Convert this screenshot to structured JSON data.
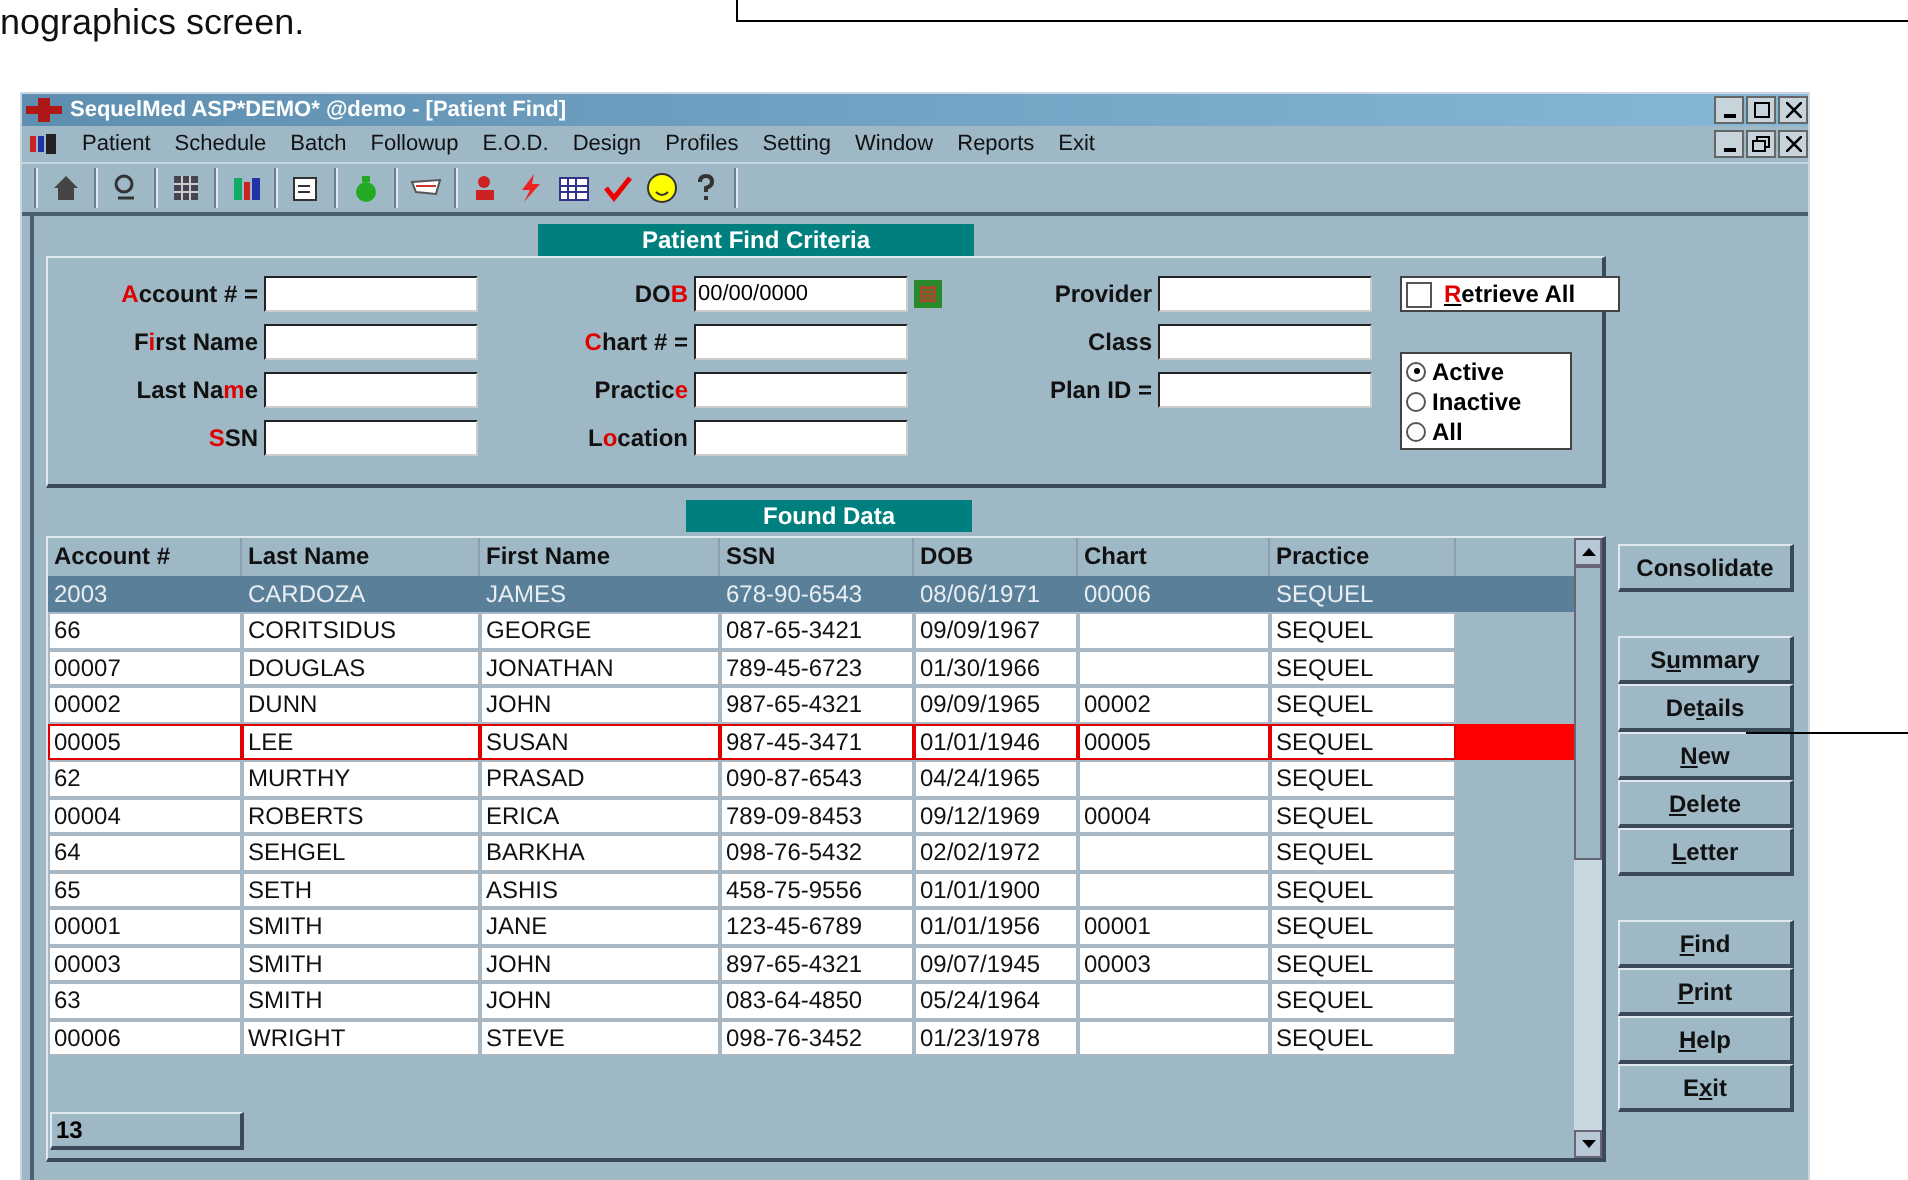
{
  "document_text": "nographics screen.",
  "window": {
    "title": "SequelMed ASP*DEMO* @demo  - [Patient Find]"
  },
  "menu": [
    "Patient",
    "Schedule",
    "Batch",
    "Followup",
    "E.O.D.",
    "Design",
    "Profiles",
    "Setting",
    "Window",
    "Reports",
    "Exit"
  ],
  "criteria": {
    "title": "Patient Find Criteria",
    "columns": [
      [
        {
          "kind": "text",
          "label": {
            "key": "A",
            "after": "ccount # ="
          }
        },
        {
          "kind": "text",
          "label": {
            "before": "F",
            "key": "i",
            "after": "rst Name"
          }
        },
        {
          "kind": "text",
          "label": {
            "before": "Last Na",
            "key": "m",
            "after": "e"
          }
        },
        {
          "kind": "text",
          "label": {
            "key": "S",
            "after": "SN"
          }
        }
      ],
      [
        {
          "kind": "date",
          "label": {
            "before": "DO",
            "key": "B"
          },
          "value": "00/00/0000"
        },
        {
          "kind": "text",
          "label": {
            "key": "C",
            "after": "hart # ="
          }
        },
        {
          "kind": "text",
          "label": {
            "before": "Practic",
            "key": "e"
          }
        },
        {
          "kind": "text",
          "label": {
            "before": "L",
            "key": "o",
            "after": "cation"
          }
        }
      ],
      [
        {
          "kind": "text",
          "label": {
            "before": "Provider"
          }
        },
        {
          "kind": "text",
          "label": {
            "before": "Class"
          }
        },
        {
          "kind": "text",
          "label": {
            "before": "Plan ID ="
          }
        }
      ]
    ],
    "retrieve_all": {
      "label": {
        "key": "R",
        "after": "etrieve All"
      },
      "checked": false
    },
    "status_options": [
      {
        "label": "Active",
        "selected": true
      },
      {
        "label": "Inactive",
        "selected": false
      },
      {
        "label": "All",
        "selected": false
      }
    ]
  },
  "found": {
    "title": "Found Data",
    "columns": [
      "Account #",
      "Last Name",
      "First Name",
      "SSN",
      "DOB",
      "Chart",
      "Practice"
    ],
    "rows": [
      {
        "cells": [
          "2003",
          "CARDOZA",
          "JAMES",
          "678-90-6543",
          "08/06/1971",
          "00006",
          "SEQUEL"
        ],
        "selected": true,
        "current": false
      },
      {
        "cells": [
          "66",
          "CORITSIDUS",
          "GEORGE",
          "087-65-3421",
          "09/09/1967",
          "",
          "SEQUEL"
        ],
        "selected": false,
        "current": false
      },
      {
        "cells": [
          "00007",
          "DOUGLAS",
          "JONATHAN",
          "789-45-6723",
          "01/30/1966",
          "",
          "SEQUEL"
        ],
        "selected": false,
        "current": false
      },
      {
        "cells": [
          "00002",
          "DUNN",
          "JOHN",
          "987-65-4321",
          "09/09/1965",
          "00002",
          "SEQUEL"
        ],
        "selected": false,
        "current": false
      },
      {
        "cells": [
          "00005",
          "LEE",
          "SUSAN",
          "987-45-3471",
          "01/01/1946",
          "00005",
          "SEQUEL"
        ],
        "selected": false,
        "current": true
      },
      {
        "cells": [
          "62",
          "MURTHY",
          "PRASAD",
          "090-87-6543",
          "04/24/1965",
          "",
          "SEQUEL"
        ],
        "selected": false,
        "current": false
      },
      {
        "cells": [
          "00004",
          "ROBERTS",
          "ERICA",
          "789-09-8453",
          "09/12/1969",
          "00004",
          "SEQUEL"
        ],
        "selected": false,
        "current": false
      },
      {
        "cells": [
          "64",
          "SEHGEL",
          "BARKHA",
          "098-76-5432",
          "02/02/1972",
          "",
          "SEQUEL"
        ],
        "selected": false,
        "current": false
      },
      {
        "cells": [
          "65",
          "SETH",
          "ASHIS",
          "458-75-9556",
          "01/01/1900",
          "",
          "SEQUEL"
        ],
        "selected": false,
        "current": false
      },
      {
        "cells": [
          "00001",
          "SMITH",
          "JANE",
          "123-45-6789",
          "01/01/1956",
          "00001",
          "SEQUEL"
        ],
        "selected": false,
        "current": false
      },
      {
        "cells": [
          "00003",
          "SMITH",
          "JOHN",
          "897-65-4321",
          "09/07/1945",
          "00003",
          "SEQUEL"
        ],
        "selected": false,
        "current": false
      },
      {
        "cells": [
          "63",
          "SMITH",
          "JOHN",
          "083-64-4850",
          "05/24/1964",
          "",
          "SEQUEL"
        ],
        "selected": false,
        "current": false
      },
      {
        "cells": [
          "00006",
          "WRIGHT",
          "STEVE",
          "098-76-3452",
          "01/23/1978",
          "",
          "SEQUEL"
        ],
        "selected": false,
        "current": false
      }
    ],
    "count": "13"
  },
  "button_groups": [
    [
      {
        "before": "Consolidate"
      }
    ],
    [
      {
        "before": "S",
        "key": "u",
        "after": "mmary"
      },
      {
        "before": "De",
        "key": "t",
        "after": "ails"
      },
      {
        "key": "N",
        "after": "ew"
      },
      {
        "key": "D",
        "after": "elete"
      },
      {
        "key": "L",
        "after": "etter"
      }
    ],
    [
      {
        "key": "F",
        "after": "ind"
      },
      {
        "key": "P",
        "after": "rint"
      },
      {
        "key": "H",
        "after": "elp"
      },
      {
        "before": "E",
        "key": "x",
        "after": "it"
      }
    ]
  ]
}
